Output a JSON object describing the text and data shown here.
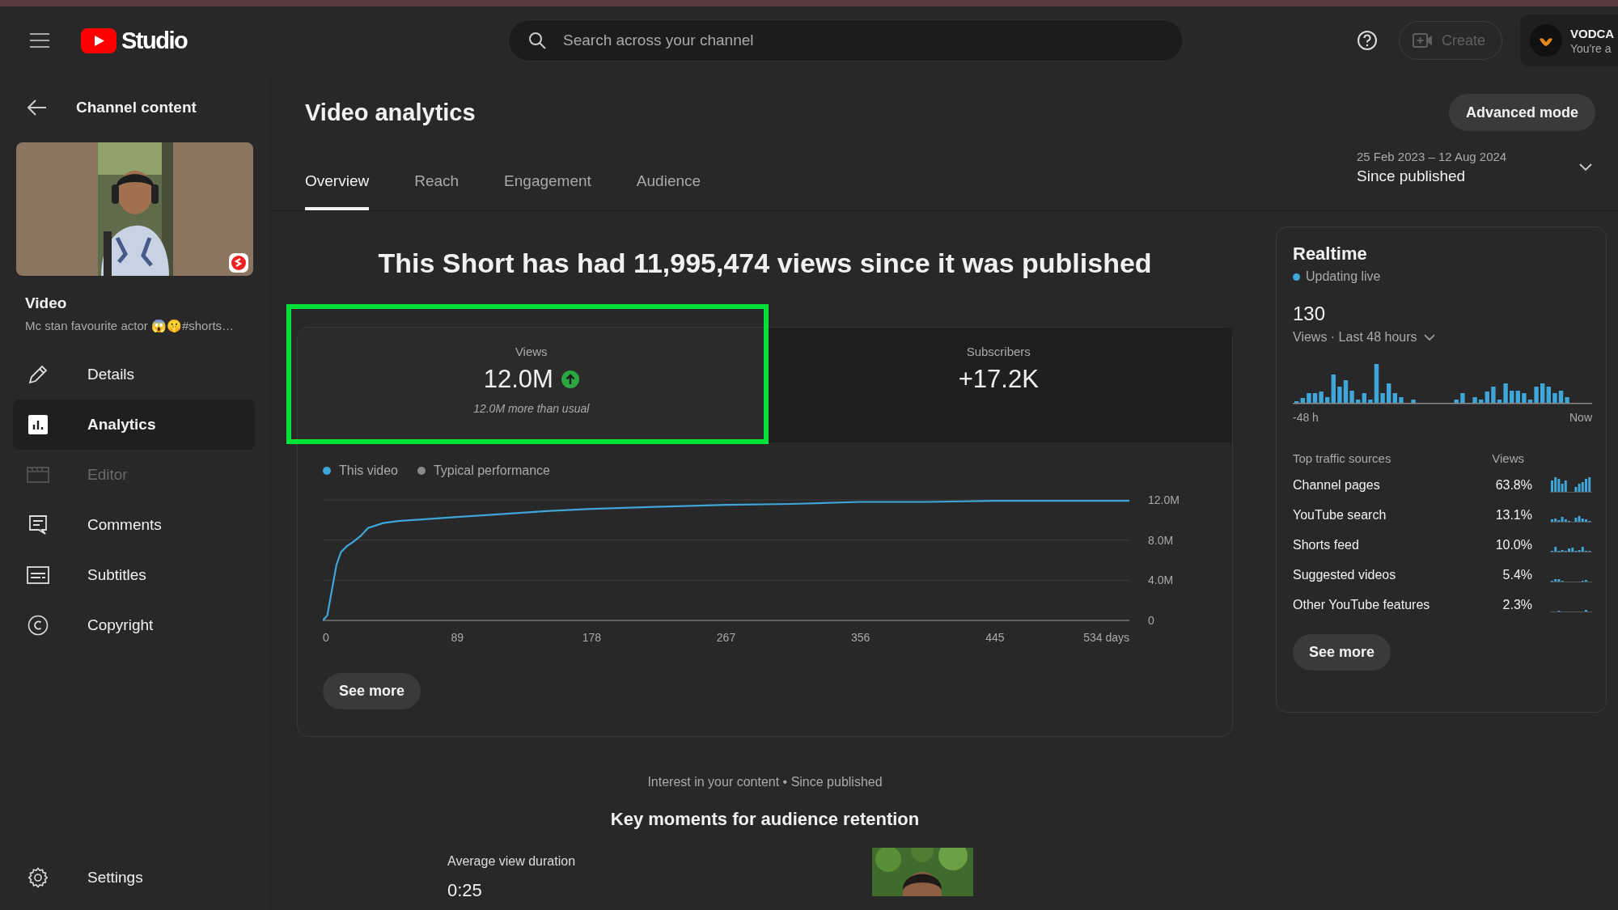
{
  "header": {
    "logo_text": "Studio",
    "search": {
      "placeholder": "Search across your channel"
    },
    "create_button": {
      "label": "Create",
      "disabled": true
    },
    "account": {
      "name": "VODCA",
      "subtitle": "You're a"
    }
  },
  "sidebar": {
    "back_label": "Channel content",
    "video_label": "Video",
    "video_title": "Mc stan favourite actor 😱🤫#shorts…",
    "items": [
      {
        "label": "Details",
        "selected": false,
        "disabled": false
      },
      {
        "label": "Analytics",
        "selected": true,
        "disabled": false
      },
      {
        "label": "Editor",
        "selected": false,
        "disabled": true
      },
      {
        "label": "Comments",
        "selected": false,
        "disabled": false
      },
      {
        "label": "Subtitles",
        "selected": false,
        "disabled": false
      },
      {
        "label": "Copyright",
        "selected": false,
        "disabled": false
      }
    ],
    "settings_label": "Settings"
  },
  "main": {
    "title": "Video analytics",
    "advanced_button": "Advanced mode",
    "tabs": [
      {
        "label": "Overview",
        "selected": true
      },
      {
        "label": "Reach",
        "selected": false
      },
      {
        "label": "Engagement",
        "selected": false
      },
      {
        "label": "Audience",
        "selected": false
      }
    ],
    "date_range": {
      "dates": "25 Feb 2023 – 12 Aug 2024",
      "label": "Since published"
    },
    "headline": "This Short has had 11,995,474 views since it was published",
    "metrics": [
      {
        "label": "Views",
        "value": "12.0M",
        "rising": true,
        "note": "12.0M more than usual",
        "selected": true,
        "highlighted": true
      },
      {
        "label": "Subscribers",
        "value": "+17.2K",
        "selected": false,
        "highlighted": false
      }
    ],
    "chart_data": {
      "type": "line",
      "x": [
        0,
        3,
        6,
        9,
        12,
        16,
        20,
        25,
        30,
        40,
        50,
        60,
        89,
        120,
        150,
        178,
        220,
        267,
        310,
        356,
        400,
        445,
        490,
        534
      ],
      "series": [
        {
          "name": "This video",
          "color": "#3ea6d8",
          "values": [
            0,
            0.5,
            3.0,
            5.5,
            6.8,
            7.4,
            7.8,
            8.4,
            9.2,
            9.7,
            9.9,
            10.0,
            10.3,
            10.6,
            10.9,
            11.1,
            11.3,
            11.5,
            11.6,
            11.8,
            11.8,
            11.9,
            11.9,
            11.9
          ]
        },
        {
          "name": "Typical performance",
          "color": "#8a8a8a",
          "values": [
            null,
            null,
            null,
            null,
            null,
            null,
            null,
            null,
            null,
            null,
            null,
            null,
            null,
            null,
            null,
            null,
            null,
            null,
            null,
            null,
            null,
            null,
            null,
            null
          ]
        }
      ],
      "xlim": [
        0,
        534
      ],
      "ylim": [
        0,
        12
      ],
      "xticks": [
        {
          "value": 0,
          "label": "0"
        },
        {
          "value": 89,
          "label": "89"
        },
        {
          "value": 178,
          "label": "178"
        },
        {
          "value": 267,
          "label": "267"
        },
        {
          "value": 356,
          "label": "356"
        },
        {
          "value": 445,
          "label": "445"
        },
        {
          "value": 534,
          "label": "534 days"
        }
      ],
      "yticks": [
        {
          "value": 0,
          "label": "0"
        },
        {
          "value": 4,
          "label": "4.0M"
        },
        {
          "value": 8,
          "label": "8.0M"
        },
        {
          "value": 12,
          "label": "12.0M"
        }
      ]
    },
    "see_more": "See more",
    "context": "Interest in your content • Since published",
    "retention_title": "Key moments for audience retention",
    "avg_label": "Average view duration",
    "avg_value": "0:25"
  },
  "realtime": {
    "title": "Realtime",
    "live": true,
    "status": "Updating live",
    "count": "130",
    "period": "Views · Last 48 hours",
    "axis_start": "-48 h",
    "axis_end": "Now",
    "sources_header": "Top traffic sources",
    "views_header": "Views",
    "sources": [
      {
        "name": "Channel pages",
        "share": "63.8%"
      },
      {
        "name": "YouTube search",
        "share": "13.1%"
      },
      {
        "name": "Shorts feed",
        "share": "10.0%"
      },
      {
        "name": "Suggested videos",
        "share": "5.4%"
      },
      {
        "name": "Other YouTube features",
        "share": "2.3%"
      }
    ],
    "see_more": "See more"
  }
}
